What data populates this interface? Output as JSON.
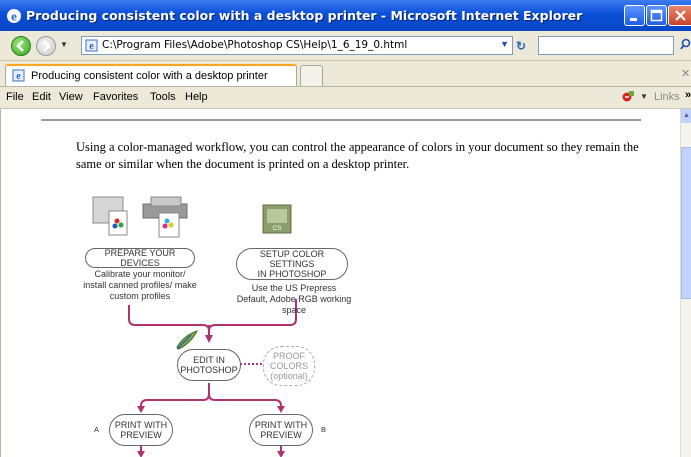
{
  "window": {
    "title": "Producing consistent color with a desktop printer - Microsoft Internet Explorer",
    "buttons": [
      "minimize",
      "maximize",
      "close"
    ]
  },
  "address_bar": {
    "url": "C:\\Program Files\\Adobe\\Photoshop CS\\Help\\1_6_19_0.html",
    "search_placeholder": ""
  },
  "tabs": [
    {
      "label": "Producing consistent color with a desktop printer"
    }
  ],
  "menu": [
    "File",
    "Edit",
    "View",
    "Favorites",
    "Tools",
    "Help"
  ],
  "toolbar_right": {
    "links_label": "Links",
    "chevron": "»"
  },
  "content": {
    "intro": "Using a color-managed workflow, you can control the appearance of colors in your document so they remain the same or similar when the document is printed on a desktop printer."
  },
  "flowchart": {
    "prepare_label": "PREPARE YOUR DEVICES",
    "prepare_caption": "Calibrate your monitor/ install canned profiles/ make custom profiles",
    "setup_label_1": "SETUP COLOR SETTINGS",
    "setup_label_2": "IN PHOTOSHOP",
    "setup_caption": "Use the US Prepress Default, Adobe RGB working space",
    "edit_label_1": "EDIT IN",
    "edit_label_2": "PHOTOSHOP",
    "proof_label_1": "PROOF",
    "proof_label_2": "COLORS",
    "proof_label_3": "(optional)",
    "print_a_label_1": "PRINT WITH",
    "print_a_label_2": "PREVIEW",
    "print_b_label_1": "PRINT WITH",
    "print_b_label_2": "PREVIEW",
    "branch_a": "A",
    "branch_b": "B",
    "cs_badge": "CS",
    "line_color": "#b0336e"
  }
}
